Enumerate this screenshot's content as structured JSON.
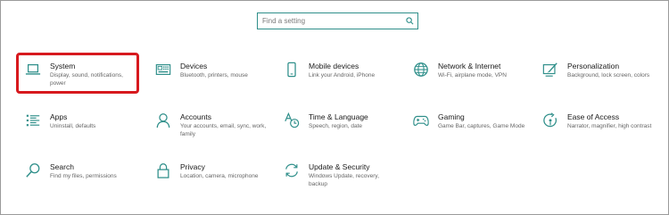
{
  "search": {
    "placeholder": "Find a setting",
    "icon": "search-icon"
  },
  "accent": "#2f8f8a",
  "highlight_color": "#d7191e",
  "tiles": [
    {
      "title": "System",
      "desc": "Display, sound, notifications, power",
      "icon": "laptop-icon"
    },
    {
      "title": "Devices",
      "desc": "Bluetooth, printers, mouse",
      "icon": "keyboard-icon"
    },
    {
      "title": "Mobile devices",
      "desc": "Link your Android, iPhone",
      "icon": "phone-icon"
    },
    {
      "title": "Network & Internet",
      "desc": "Wi-Fi, airplane mode, VPN",
      "icon": "globe-icon"
    },
    {
      "title": "Personalization",
      "desc": "Background, lock screen, colors",
      "icon": "paint-icon"
    },
    {
      "title": "Apps",
      "desc": "Uninstall, defaults",
      "icon": "apps-list-icon"
    },
    {
      "title": "Accounts",
      "desc": "Your accounts, email, sync, work, family",
      "icon": "person-icon"
    },
    {
      "title": "Time & Language",
      "desc": "Speech, region, date",
      "icon": "time-language-icon"
    },
    {
      "title": "Gaming",
      "desc": "Game Bar, captures, Game Mode",
      "icon": "gamepad-icon"
    },
    {
      "title": "Ease of Access",
      "desc": "Narrator, magnifier, high contrast",
      "icon": "ease-of-access-icon"
    },
    {
      "title": "Search",
      "desc": "Find my files, permissions",
      "icon": "search-icon"
    },
    {
      "title": "Privacy",
      "desc": "Location, camera, microphone",
      "icon": "lock-icon"
    },
    {
      "title": "Update & Security",
      "desc": "Windows Update, recovery, backup",
      "icon": "update-icon"
    }
  ]
}
